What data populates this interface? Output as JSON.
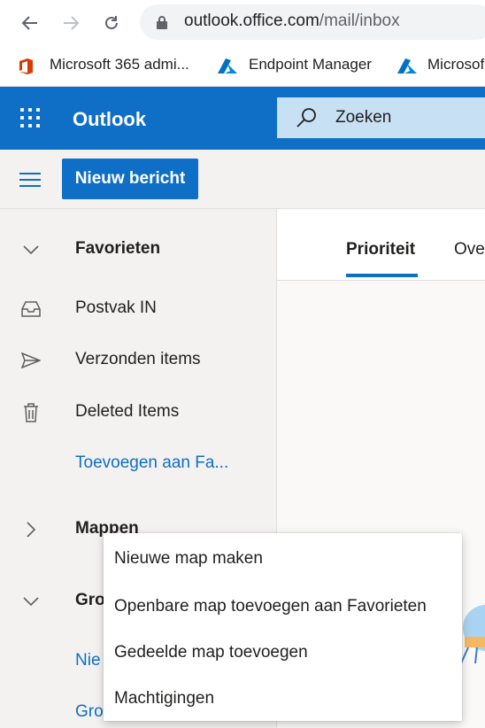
{
  "browser": {
    "back_icon": "arrow-left-icon",
    "forward_icon": "arrow-right-icon",
    "reload_icon": "reload-icon",
    "lock_icon": "lock-icon",
    "url_host": "outlook.office.com",
    "url_path": "/mail/inbox",
    "bookmarks": [
      {
        "label": "Microsoft 365 admi...",
        "icon": "office-logo-icon",
        "color": "#d83b01"
      },
      {
        "label": "Endpoint Manager",
        "icon": "azure-logo-icon",
        "color": "#0072c6"
      },
      {
        "label": "Microsof",
        "icon": "azure-logo-icon",
        "color": "#0072c6"
      }
    ]
  },
  "header": {
    "app_title": "Outlook",
    "search_placeholder": "Zoeken",
    "accent": "#0f6ec6"
  },
  "command_bar": {
    "new_message_label": "Nieuw bericht"
  },
  "nav": {
    "favorites": {
      "label": "Favorieten",
      "icon": "chevron-down-icon"
    },
    "items": [
      {
        "label": "Postvak IN",
        "icon": "inbox-icon"
      },
      {
        "label": "Verzonden items",
        "icon": "send-icon"
      },
      {
        "label": "Deleted Items",
        "icon": "trash-icon"
      }
    ],
    "add_to_favorites": "Toevoegen aan Fa...",
    "folders": {
      "label": "Mappen",
      "icon": "chevron-right-icon"
    },
    "groups": {
      "label": "Gro",
      "icon": "chevron-down-icon"
    },
    "new_group_fragment": "Nie",
    "groups_fragment": "Grou"
  },
  "main": {
    "tabs": [
      {
        "label": "Prioriteit",
        "active": true
      },
      {
        "label": "Ove",
        "active": false
      }
    ]
  },
  "context_menu": {
    "items": [
      "Nieuwe map maken",
      "Openbare map toevoegen aan Favorieten",
      "Gedeelde map toevoegen",
      "Machtigingen"
    ]
  }
}
